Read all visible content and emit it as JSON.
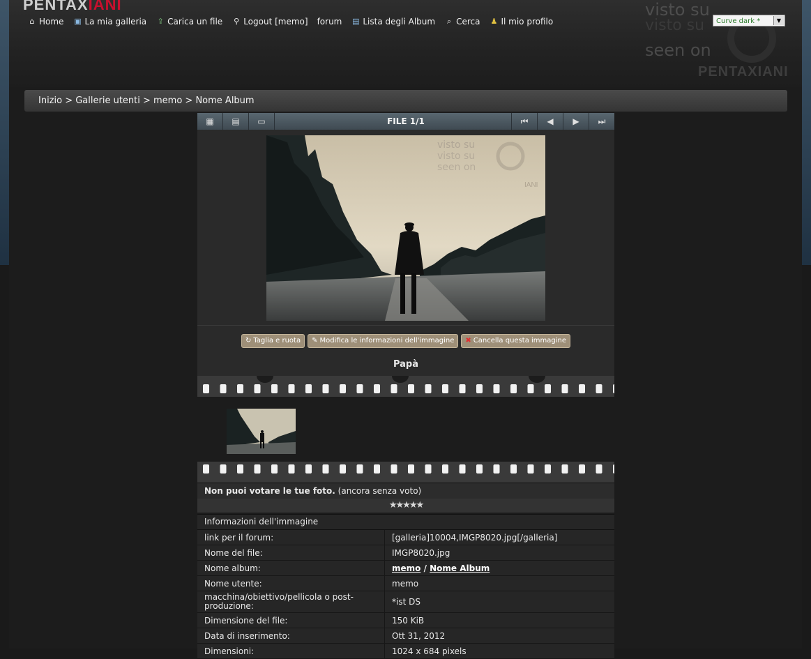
{
  "logo": {
    "part1": "PENTAX",
    "part2": "IANI"
  },
  "nav": [
    {
      "label": "Home",
      "icon": "home-icon",
      "glyph": "⌂"
    },
    {
      "label": "La mia galleria",
      "icon": "gallery-icon",
      "glyph": "▣"
    },
    {
      "label": "Carica un file",
      "icon": "upload-icon",
      "glyph": "⇪"
    },
    {
      "label": "Logout [memo]",
      "icon": "logout-icon",
      "glyph": "⚲"
    },
    {
      "label": "forum",
      "icon": "",
      "glyph": ""
    },
    {
      "label": "Lista degli Album",
      "icon": "album-list-icon",
      "glyph": "▤"
    },
    {
      "label": "Cerca",
      "icon": "search-icon",
      "glyph": "⌕"
    },
    {
      "label": "Il mio profilo",
      "icon": "profile-icon",
      "glyph": "♟"
    }
  ],
  "watermark": {
    "line1": "visto su",
    "line2": "visto su",
    "line3": "seen on",
    "brand": "PENTAXIANI"
  },
  "theme_select": {
    "value": "Curve dark *"
  },
  "breadcrumb": "Inizio > Gallerie utenti > memo > Nome Album",
  "toolbar": {
    "title": "FILE 1/1"
  },
  "actions": {
    "crop": "Taglia e ruota",
    "edit": "Modifica le informazioni dell'immagine",
    "delete": "Cancella questa immagine"
  },
  "caption": "Papà",
  "vote": {
    "bold": "Non puoi votare le tue foto.",
    "rest": " (ancora senza voto)"
  },
  "stars": "★★★★★",
  "info": {
    "header": "Informazioni dell'immagine",
    "rows": {
      "forum_link": {
        "k": "link per il forum:",
        "v": "[galleria]10004,IMGP8020.jpg[/galleria]"
      },
      "filename": {
        "k": "Nome del file:",
        "v": "IMGP8020.jpg"
      },
      "album": {
        "k": "Nome album:",
        "v1": "memo",
        "sep": " / ",
        "v2": "Nome Album"
      },
      "user": {
        "k": "Nome utente:",
        "v": "memo"
      },
      "camera": {
        "k": "macchina/obiettivo/pellicola o post-produzione:",
        "v": "*ist DS"
      },
      "size": {
        "k": "Dimensione del file:",
        "v": "150 KiB"
      },
      "date": {
        "k": "Data di inserimento:",
        "v": "Ott 31, 2012"
      },
      "dims": {
        "k": "Dimensioni:",
        "v": "1024 x 684 pixels"
      }
    }
  },
  "colors": {
    "accent_red": "#c8102e",
    "button_bg": "#9e8f78",
    "toolbar": "#4f5c65"
  }
}
